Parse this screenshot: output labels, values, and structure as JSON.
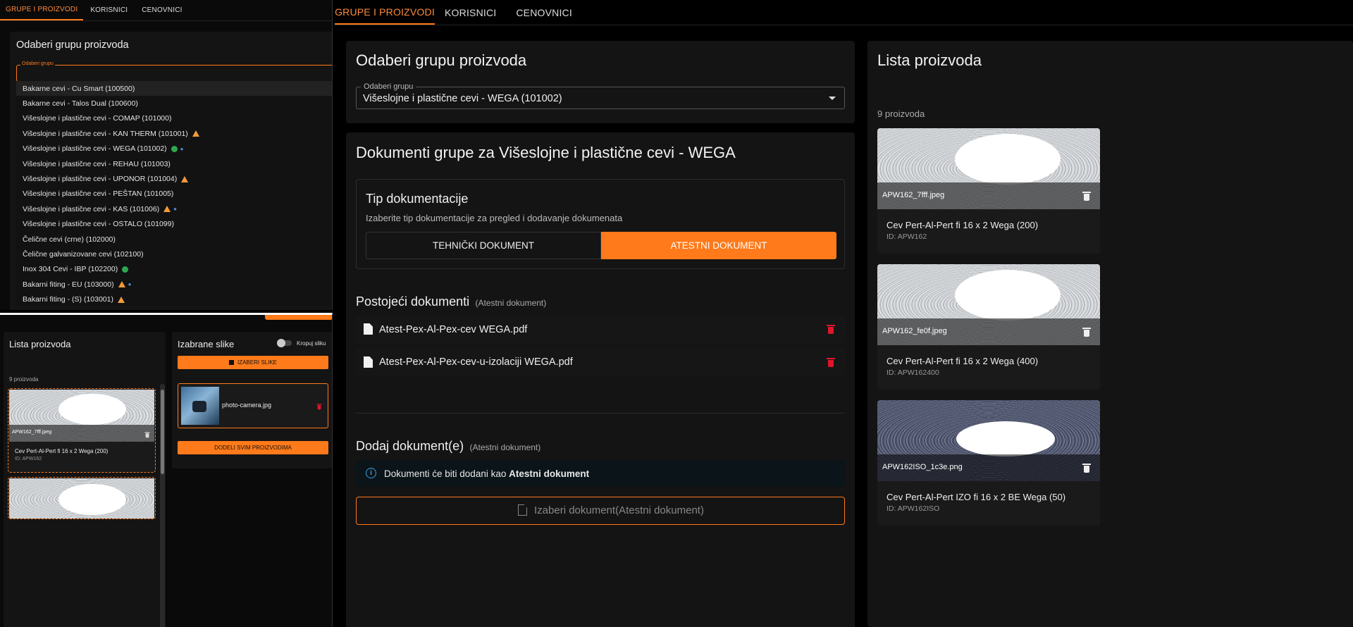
{
  "tabs": [
    "GRUPE I PROIZVODI",
    "KORISNICI",
    "CENOVNICI"
  ],
  "left_top": {
    "select_group_title": "Odaberi grupu proizvoda",
    "select_label": "Odaberi grupu",
    "options": [
      {
        "label": "Bakarne cevi - Cu Smart (100500)",
        "flags": ""
      },
      {
        "label": "Bakarne cevi - Talos Dual (100600)",
        "flags": ""
      },
      {
        "label": "Višeslojne i plastične cevi - COMAP (101000)",
        "flags": ""
      },
      {
        "label": "Višeslojne i plastične cevi - KAN THERM (101001)",
        "flags": "warn"
      },
      {
        "label": "Višeslojne i plastične cevi - WEGA (101002)",
        "flags": "ok-mini-A"
      },
      {
        "label": "Višeslojne i plastične cevi - REHAU (101003)",
        "flags": ""
      },
      {
        "label": "Višeslojne i plastične cevi - UPONOR (101004)",
        "flags": "warn"
      },
      {
        "label": "Višeslojne i plastične cevi - PEŠTAN (101005)",
        "flags": ""
      },
      {
        "label": "Višeslojne i plastične cevi - KAS (101006)",
        "flags": "warn-mini-T"
      },
      {
        "label": "Višeslojne i plastične cevi - OSTALO (101099)",
        "flags": ""
      },
      {
        "label": "Čelične cevi (crne) (102000)",
        "flags": ""
      },
      {
        "label": "Čelične galvanizovane cevi (102100)",
        "flags": ""
      },
      {
        "label": "Inox 304 Cevi - IBP (102200)",
        "flags": "ok"
      },
      {
        "label": "Bakarni fiting - EU (103000)",
        "flags": "warn-mini-A"
      },
      {
        "label": "Bakarni fiting - (S) (103001)",
        "flags": "warn"
      }
    ]
  },
  "left_bottom": {
    "products_title": "Lista proizvoda",
    "products_count": "9 proizvoda",
    "product": {
      "file": "APW162_7fff.jpeg",
      "name": "Cev Pert-Al-Pert fi 16 x 2 Wega (200)",
      "id": "ID: APW162"
    },
    "images_title": "Izabrane slike",
    "crop_label": "Kropuj sliku",
    "choose_images": "IZABERI SLIKE",
    "image_file": "photo-camera.jpg",
    "assign_all": "DODELI SVIM PROIZVODIMA"
  },
  "main": {
    "select_group_title": "Odaberi grupu proizvoda",
    "select_label": "Odaberi grupu",
    "select_value": "Višeslojne i plastične cevi - WEGA (101002)",
    "docs_title": "Dokumenti grupe za Višeslojne i plastične cevi - WEGA",
    "doc_type_title": "Tip dokumentacije",
    "doc_type_hint": "Izaberite tip dokumentacije za pregled i dodavanje dokumenata",
    "doc_type_options": [
      "TEHNIČKI DOKUMENT",
      "ATESTNI DOKUMENT"
    ],
    "existing_title": "Postojeći dokumenti",
    "existing_sub": "(Atestni dokument)",
    "existing_files": [
      "Atest-Pex-Al-Pex-cev WEGA.pdf",
      "Atest-Pex-Al-Pex-cev-u-izolaciji WEGA.pdf"
    ],
    "add_title": "Dodaj dokument(e)",
    "add_sub": "(Atestni dokument)",
    "info_prefix": "Dokumenti će biti dodani kao",
    "info_bold": "Atestni dokument",
    "choose_doc": "Izaberi dokument(Atestni dokument)"
  },
  "right": {
    "title": "Lista proizvoda",
    "count": "9 proizvoda",
    "products": [
      {
        "file": "APW162_7fff.jpeg",
        "name": "Cev Pert-Al-Pert fi 16 x 2 Wega (200)",
        "id": "ID: APW162"
      },
      {
        "file": "APW162_fe0f.jpeg",
        "name": "Cev Pert-Al-Pert fi 16 x 2 Wega (400)",
        "id": "ID: APW162400"
      },
      {
        "file": "APW162ISO_1c3e.png",
        "name": "Cev Pert-Al-Pert IZO fi 16 x 2 BE Wega (50)",
        "id": "ID: APW162ISO"
      }
    ]
  },
  "colors": {
    "accent": "#ff7a1a",
    "danger": "#e0162b",
    "ok": "#2ea84f",
    "warn": "#f29b38"
  }
}
